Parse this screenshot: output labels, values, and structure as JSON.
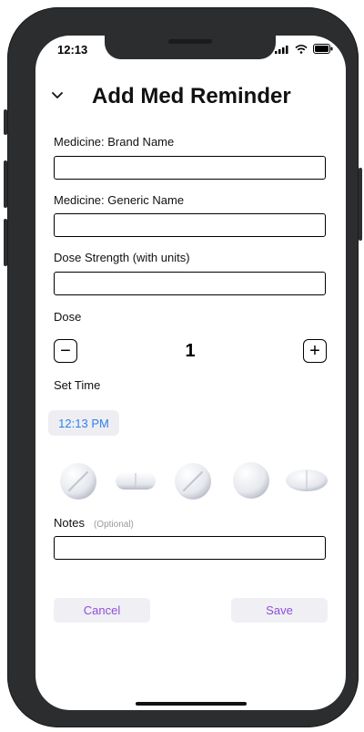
{
  "status_bar": {
    "time": "12:13",
    "icons": [
      "signal-icon",
      "wifi-icon",
      "battery-icon"
    ]
  },
  "header": {
    "back_icon": "chevron-down-icon",
    "title": "Add Med Reminder"
  },
  "form": {
    "brand_name": {
      "label": "Medicine: Brand Name",
      "value": ""
    },
    "generic_name": {
      "label": "Medicine: Generic Name",
      "value": ""
    },
    "dose_strength": {
      "label": "Dose Strength (with units)",
      "value": ""
    },
    "dose": {
      "label": "Dose",
      "value": "1",
      "minus": "−",
      "plus": "+"
    },
    "set_time": {
      "label": "Set Time",
      "value": "12:13 PM"
    },
    "pill_shapes": [
      "round-scored-pill",
      "capsule-pill",
      "round-scored-pill",
      "round-pill",
      "oval-pill"
    ],
    "notes": {
      "label": "Notes",
      "optional": "(Optional)",
      "value": ""
    }
  },
  "actions": {
    "cancel": "Cancel",
    "save": "Save"
  },
  "colors": {
    "accent": "#8e4fd6",
    "time_blue": "#2f80ed",
    "button_bg": "#f0eff4",
    "frame": "#2b2d2f"
  }
}
